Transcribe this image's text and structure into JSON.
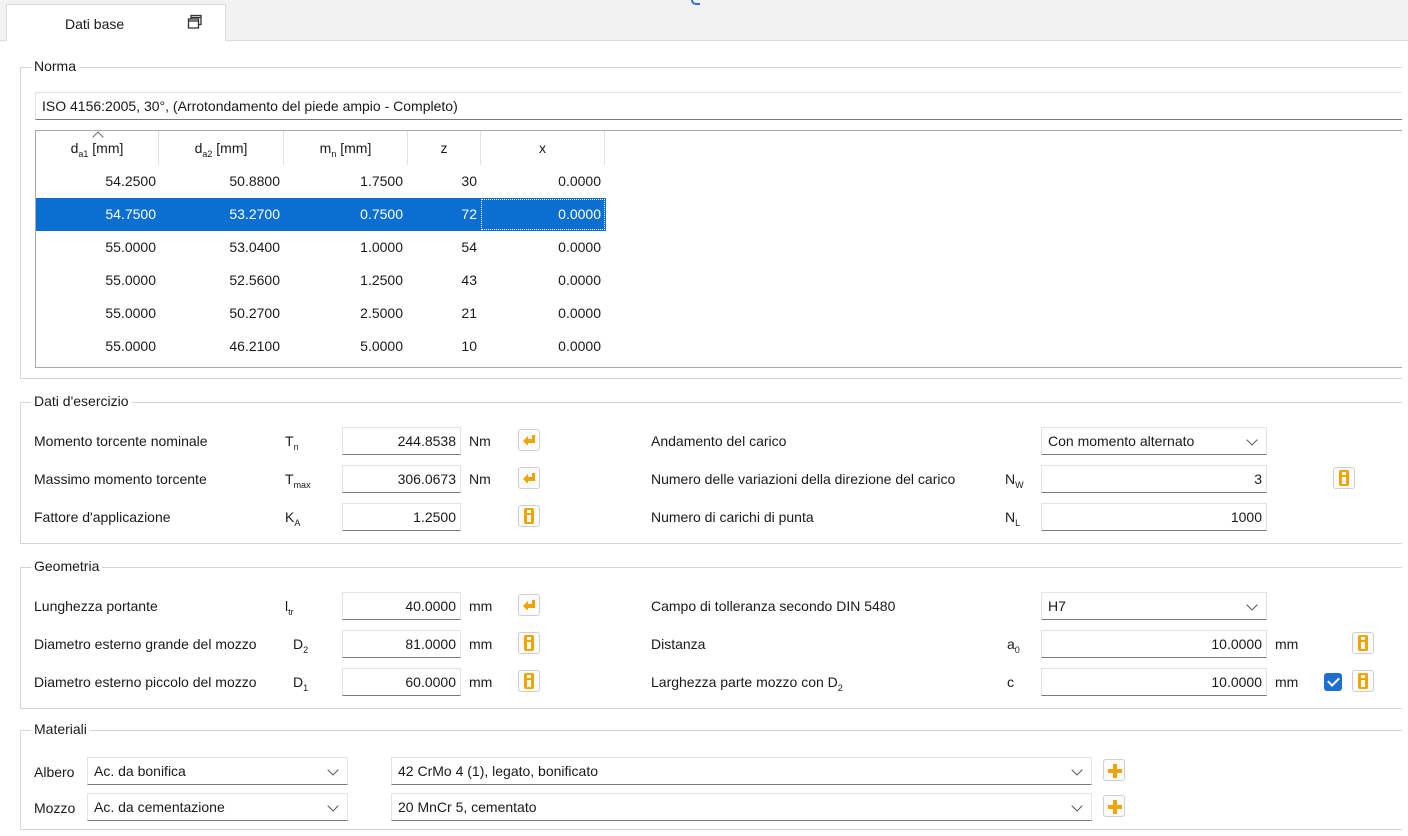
{
  "tab": {
    "label": "Dati base",
    "icon": "restore-window-icon"
  },
  "norma": {
    "title": "Norma",
    "standard": "ISO 4156:2005, 30°, (Arrotondamento del piede ampio - Completo)",
    "table": {
      "headers": [
        {
          "main": "d",
          "sub": "a1",
          "rest": " [mm]"
        },
        {
          "main": "d",
          "sub": "a2",
          "rest": " [mm]"
        },
        {
          "main": "m",
          "sub": "n",
          "rest": " [mm]"
        },
        {
          "main": "z",
          "sub": "",
          "rest": ""
        },
        {
          "main": "x",
          "sub": "",
          "rest": ""
        }
      ],
      "rows": [
        [
          "54.2500",
          "50.8800",
          "1.7500",
          "30",
          "0.0000"
        ],
        [
          "54.7500",
          "53.2700",
          "0.7500",
          "72",
          "0.0000"
        ],
        [
          "55.0000",
          "53.0400",
          "1.0000",
          "54",
          "0.0000"
        ],
        [
          "55.0000",
          "52.5600",
          "1.2500",
          "43",
          "0.0000"
        ],
        [
          "55.0000",
          "50.2700",
          "2.5000",
          "21",
          "0.0000"
        ],
        [
          "55.0000",
          "46.2100",
          "5.0000",
          "10",
          "0.0000"
        ]
      ],
      "selected_row": 1
    }
  },
  "esercizio": {
    "title": "Dati d'esercizio",
    "left": [
      {
        "label": "Momento torcente nominale",
        "sym": "T",
        "sub": "n",
        "value": "244.8538",
        "unit": "Nm",
        "button": "arrow-left-icon"
      },
      {
        "label": "Massimo momento torcente",
        "sym": "T",
        "sub": "max",
        "value": "306.0673",
        "unit": "Nm",
        "button": "arrow-left-icon"
      },
      {
        "label": "Fattore d'applicazione",
        "sym": "K",
        "sub": "A",
        "value": "1.2500",
        "unit": "",
        "button": "info-icon"
      }
    ],
    "right": [
      {
        "label": "Andamento del carico",
        "sym": "",
        "sub": "",
        "value": "Con momento alternato",
        "type": "combo"
      },
      {
        "label": "Numero delle variazioni della direzione del carico",
        "sym": "N",
        "sub": "W",
        "value": "3",
        "type": "number"
      },
      {
        "label": "Numero di carichi di punta",
        "sym": "N",
        "sub": "L",
        "value": "1000",
        "type": "number"
      }
    ]
  },
  "geometria": {
    "title": "Geometria",
    "left": [
      {
        "label": "Lunghezza portante",
        "sym": "l",
        "sub": "tr",
        "value": "40.0000",
        "unit": "mm",
        "button": "arrow-left-icon"
      },
      {
        "label": "Diametro esterno grande del mozzo",
        "sym": "D",
        "sub": "2",
        "value": "81.0000",
        "unit": "mm",
        "button": "info-icon"
      },
      {
        "label": "Diametro esterno piccolo del mozzo",
        "sym": "D",
        "sub": "1",
        "value": "60.0000",
        "unit": "mm",
        "button": "info-icon"
      }
    ],
    "right": [
      {
        "label": "Campo di tolleranza secondo DIN 5480",
        "sym": "",
        "sub": "",
        "value": "H7",
        "unit": "",
        "type": "combo"
      },
      {
        "label": "Distanza",
        "sym": "a",
        "sub": "0",
        "value": "10.0000",
        "unit": "mm",
        "type": "number"
      },
      {
        "label_main": "Larghezza parte mozzo con D",
        "label_sub": "2",
        "sym": "c",
        "sub": "",
        "value": "10.0000",
        "unit": "mm",
        "type": "number",
        "checked": true
      }
    ]
  },
  "materiali": {
    "title": "Materiali",
    "rows": [
      {
        "label": "Albero",
        "type": "Ac. da bonifica",
        "material": "42 CrMo 4 (1), legato, bonificato"
      },
      {
        "label": "Mozzo",
        "type": "Ac. da cementazione",
        "material": "20 MnCr 5, cementato"
      }
    ]
  },
  "colors": {
    "selection": "#0b6fd2",
    "accent_icon": "#f0a400",
    "checkbox": "#1e6fd0"
  }
}
